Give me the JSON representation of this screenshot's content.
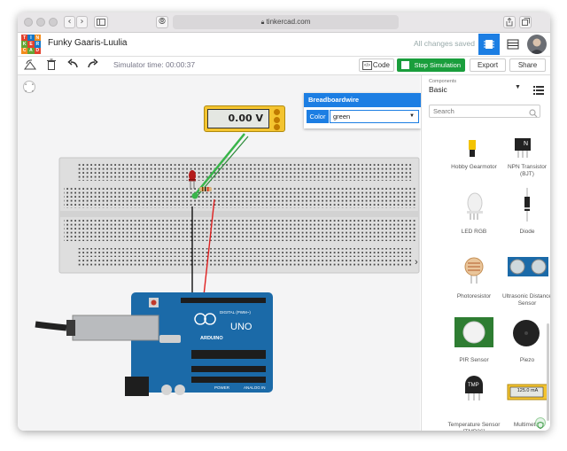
{
  "browser": {
    "url": "tinkercad.com",
    "reader_glyph": "⦾",
    "nav_back": "‹",
    "nav_forward": "›"
  },
  "logo": {
    "letters": [
      "TIN",
      "KER",
      "CAD"
    ],
    "colors": [
      "#e2412d",
      "#1478c8",
      "#f28b1c",
      "#64a533",
      "#e2412d",
      "#1478c8",
      "#f28b1c",
      "#64a533",
      "#e2412d"
    ]
  },
  "app": {
    "design_title": "Funky Gaaris-Luulia",
    "save_status": "All changes saved"
  },
  "toolbar": {
    "sim_time": "Simulator time: 00:00:37",
    "code_label": "Code",
    "simulate_label": "Stop Simulation",
    "export_label": "Export",
    "share_label": "Share"
  },
  "breadboardwire": {
    "title": "Breadboardwire",
    "color_label": "Color",
    "color_value": "green"
  },
  "multimeter": {
    "reading": "0.00 V"
  },
  "arduino": {
    "brand": "ARDUINO",
    "model": "UNO",
    "digital_label": "DIGITAL (PWM~)",
    "power_label": "POWER",
    "analog_label": "ANALOG IN"
  },
  "components": {
    "label": "Components",
    "category": "Basic",
    "search_placeholder": "Search",
    "items": [
      {
        "name": "Hobby Gearmotor"
      },
      {
        "name": "NPN Transistor (BJT)"
      },
      {
        "name": "LED RGB"
      },
      {
        "name": "Diode"
      },
      {
        "name": "Photoresistor"
      },
      {
        "name": "Ultrasonic Distance Sensor"
      },
      {
        "name": "PIR Sensor"
      },
      {
        "name": "Piezo"
      },
      {
        "name": "Temperature Sensor [TMP36]"
      },
      {
        "name": "Multimeter"
      }
    ],
    "tmp_label": "TMP",
    "npn_label": "N",
    "mm_reading": "125.0 mA"
  },
  "colors": {
    "accent": "#1c7ee3",
    "sim_green": "#1a9e3c",
    "board_blue": "#1b6aa8",
    "wire_green": "#39b54a",
    "wire_red": "#e02020"
  }
}
